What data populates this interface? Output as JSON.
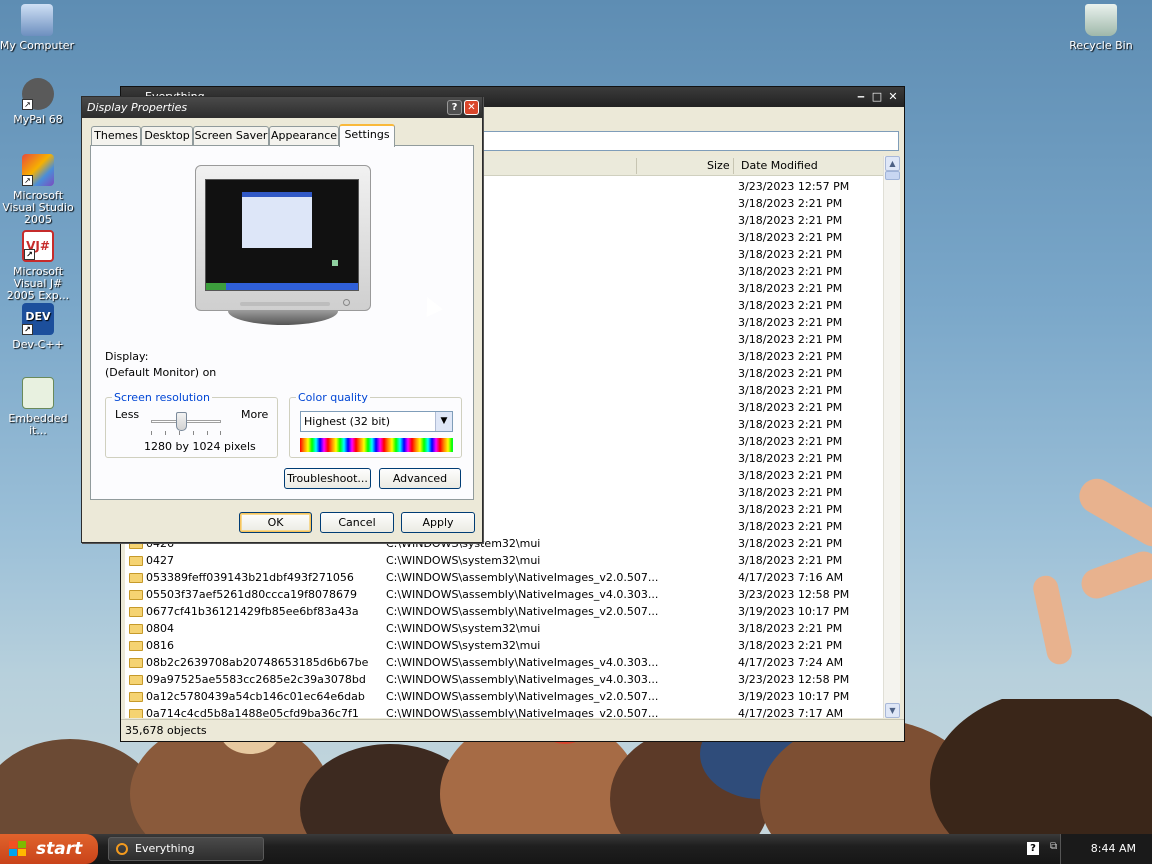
{
  "desktop": {
    "icons": [
      {
        "label": "My Computer",
        "icon": "my-computer-icon"
      },
      {
        "label": "MyPal 68",
        "icon": "mypal-icon"
      },
      {
        "label": "Microsoft Visual Studio 2005",
        "icon": "visual-studio-icon"
      },
      {
        "label": "Microsoft Visual J# 2005 Exp...",
        "icon": "visual-jsharp-icon"
      },
      {
        "label": "Dev-C++",
        "icon": "devcpp-icon"
      },
      {
        "label": "Embedded it...",
        "icon": "embedded-file-icon"
      },
      {
        "label": "Recycle Bin",
        "icon": "recycle-bin-icon"
      }
    ]
  },
  "everything": {
    "title": "Everything",
    "columns": {
      "size": "Size",
      "date_modified": "Date Modified"
    },
    "rows": [
      {
        "name": "",
        "path": "stem32\\mui",
        "date": "3/23/2023 12:57 PM"
      },
      {
        "name": "",
        "path": "stem32\\mui",
        "date": "3/18/2023 2:21 PM"
      },
      {
        "name": "",
        "path": "stem32\\mui",
        "date": "3/18/2023 2:21 PM"
      },
      {
        "name": "",
        "path": "stem32\\mui",
        "date": "3/18/2023 2:21 PM"
      },
      {
        "name": "",
        "path": "stem32\\mui",
        "date": "3/18/2023 2:21 PM"
      },
      {
        "name": "",
        "path": "stem32\\mui",
        "date": "3/18/2023 2:21 PM"
      },
      {
        "name": "",
        "path": "stem32\\mui",
        "date": "3/18/2023 2:21 PM"
      },
      {
        "name": "",
        "path": "stem32\\mui",
        "date": "3/18/2023 2:21 PM"
      },
      {
        "name": "",
        "path": "stem32\\mui",
        "date": "3/18/2023 2:21 PM"
      },
      {
        "name": "",
        "path": "stem32\\mui",
        "date": "3/18/2023 2:21 PM"
      },
      {
        "name": "",
        "path": "stem32\\mui",
        "date": "3/18/2023 2:21 PM"
      },
      {
        "name": "",
        "path": "stem32\\mui",
        "date": "3/18/2023 2:21 PM"
      },
      {
        "name": "",
        "path": "stem32\\mui",
        "date": "3/18/2023 2:21 PM"
      },
      {
        "name": "",
        "path": "stem32\\mui",
        "date": "3/18/2023 2:21 PM"
      },
      {
        "name": "",
        "path": "stem32\\mui",
        "date": "3/18/2023 2:21 PM"
      },
      {
        "name": "",
        "path": "stem32\\mui",
        "date": "3/18/2023 2:21 PM"
      },
      {
        "name": "",
        "path": "stem32\\mui",
        "date": "3/18/2023 2:21 PM"
      },
      {
        "name": "",
        "path": "stem32\\mui",
        "date": "3/18/2023 2:21 PM"
      },
      {
        "name": "",
        "path": "stem32\\mui",
        "date": "3/18/2023 2:21 PM"
      },
      {
        "name": "",
        "path": "stem32\\mui",
        "date": "3/18/2023 2:21 PM"
      },
      {
        "name": "",
        "path": "stem32\\mui",
        "date": "3/18/2023 2:21 PM"
      },
      {
        "name": "0426",
        "path": "C:\\WINDOWS\\system32\\mui",
        "date": "3/18/2023 2:21 PM"
      },
      {
        "name": "0427",
        "path": "C:\\WINDOWS\\system32\\mui",
        "date": "3/18/2023 2:21 PM"
      },
      {
        "name": "053389feff039143b21dbf493f271056",
        "path": "C:\\WINDOWS\\assembly\\NativeImages_v2.0.507...",
        "date": "4/17/2023 7:16 AM"
      },
      {
        "name": "05503f37aef5261d80ccca19f8078679",
        "path": "C:\\WINDOWS\\assembly\\NativeImages_v4.0.303...",
        "date": "3/23/2023 12:58 PM"
      },
      {
        "name": "0677cf41b36121429fb85ee6bf83a43a",
        "path": "C:\\WINDOWS\\assembly\\NativeImages_v2.0.507...",
        "date": "3/19/2023 10:17 PM"
      },
      {
        "name": "0804",
        "path": "C:\\WINDOWS\\system32\\mui",
        "date": "3/18/2023 2:21 PM"
      },
      {
        "name": "0816",
        "path": "C:\\WINDOWS\\system32\\mui",
        "date": "3/18/2023 2:21 PM"
      },
      {
        "name": "08b2c2639708ab20748653185d6b67be",
        "path": "C:\\WINDOWS\\assembly\\NativeImages_v4.0.303...",
        "date": "4/17/2023 7:24 AM"
      },
      {
        "name": "09a97525ae5583cc2685e2c39a3078bd",
        "path": "C:\\WINDOWS\\assembly\\NativeImages_v4.0.303...",
        "date": "3/23/2023 12:58 PM"
      },
      {
        "name": "0a12c5780439a54cb146c01ec64e6dab",
        "path": "C:\\WINDOWS\\assembly\\NativeImages_v2.0.507...",
        "date": "3/19/2023 10:17 PM"
      },
      {
        "name": "0a714c4cd5b8a1488e05cfd9ba36c7f1",
        "path": "C:\\WINDOWS\\assembly\\NativeImages_v2.0.507...",
        "date": "4/17/2023 7:17 AM"
      }
    ],
    "status": "35,678 objects"
  },
  "dialog": {
    "title": "Display Properties",
    "tabs": [
      "Themes",
      "Desktop",
      "Screen Saver",
      "Appearance",
      "Settings"
    ],
    "active_tab": "Settings",
    "display_label": "Display:",
    "display_value": "(Default Monitor) on",
    "screen_resolution": {
      "title": "Screen resolution",
      "less": "Less",
      "more": "More",
      "value": "1280 by 1024 pixels"
    },
    "color_quality": {
      "title": "Color quality",
      "selected": "Highest (32 bit)"
    },
    "troubleshoot_label": "Troubleshoot...",
    "advanced_label": "Advanced",
    "ok_label": "OK",
    "cancel_label": "Cancel",
    "apply_label": "Apply",
    "help_glyph": "?",
    "close_glyph": "✕"
  },
  "taskbar": {
    "start_label": "start",
    "task_label": "Everything",
    "clock": "8:44 AM"
  },
  "colors": {
    "xp_start": "#d9532a",
    "dialog_bg": "#ece9d8",
    "group_title": "#0046d5",
    "tab_highlight": "#f9b93b"
  }
}
